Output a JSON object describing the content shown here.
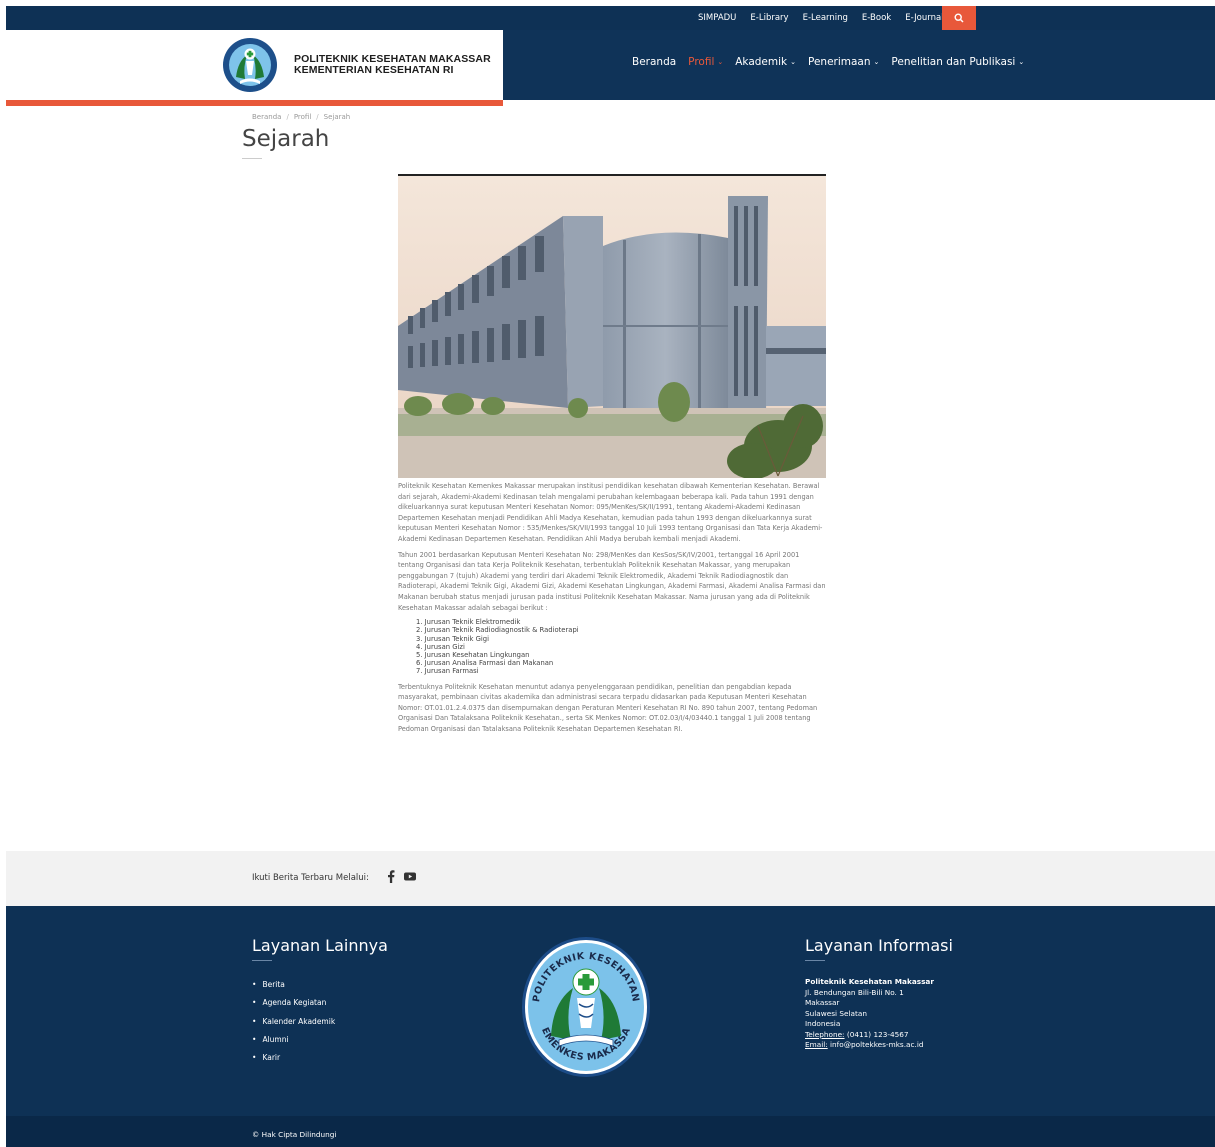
{
  "topbar": {
    "links": [
      "SIMPADU",
      "E-Library",
      "E-Learning",
      "E-Book",
      "E-Journal"
    ],
    "search_icon": "search-icon"
  },
  "header": {
    "logo_line1": "POLITEKNIK KESEHATAN MAKASSAR",
    "logo_line2": "KEMENTERIAN KESEHATAN RI",
    "nav": [
      {
        "label": "Beranda"
      },
      {
        "label": "Profil"
      },
      {
        "label": "Akademik"
      },
      {
        "label": "Penerimaan"
      },
      {
        "label": "Penelitian dan Publikasi"
      }
    ]
  },
  "breadcrumb": [
    "Beranda",
    "Profil",
    "Sejarah"
  ],
  "page_title": "Sejarah",
  "article": {
    "paragraph1": "Politeknik Kesehatan Kemenkes Makassar merupakan institusi pendidikan kesehatan dibawah Kementerian Kesehatan. Berawal dari sejarah, Akademi-Akademi Kedinasan telah mengalami perubahan kelembagaan beberapa kali. Pada tahun 1991 dengan dikeluarkannya surat keputusan Menteri Kesehatan Nomor: 095/MenKes/SK/II/1991, tentang Akademi-Akademi Kedinasan Departemen Kesehatan menjadi Pendidikan Ahli Madya Kesehatan, kemudian pada tahun 1993 dengan dikeluarkannya surat keputusan Menteri Kesehatan Nomor : 535/Menkes/SK/VII/1993 tanggal 10 Juli 1993 tentang Organisasi dan Tata Kerja Akademi-Akademi Kedinasan Departemen Kesehatan. Pendidikan Ahli Madya berubah kembali menjadi Akademi.",
    "paragraph2": "Tahun 2001 berdasarkan Keputusan Menteri Kesehatan No: 298/MenKes dan KesSos/SK/IV/2001, tertanggal 16 April 2001 tentang Organisasi dan tata Kerja Politeknik Kesehatan, terbentuklah Politeknik Kesehatan Makassar, yang merupakan penggabungan 7 (tujuh) Akademi yang terdiri dari Akademi Teknik Elektromedik, Akademi Teknik Radiodiagnostik dan Radioterapi, Akademi Teknik Gigi, Akademi Gizi, Akademi Kesehatan Lingkungan, Akademi Farmasi, Akademi Analisa Farmasi dan Makanan berubah status menjadi jurusan pada institusi Politeknik Kesehatan Makassar. Nama jurusan yang ada di Politeknik Kesehatan Makassar adalah sebagai berikut :",
    "list": [
      "1. Jurusan Teknik Elektromedik",
      "2. Jurusan Teknik Radiodiagnostik & Radioterapi",
      "3. Jurusan Teknik Gigi",
      "4. Jurusan Gizi",
      "5. Jurusan Kesehatan Lingkungan",
      "6. Jurusan Analisa Farmasi dan Makanan",
      "7. Jurusan Farmasi"
    ],
    "paragraph3": "Terbentuknya Politeknik Kesehatan menuntut adanya penyelenggaraan pendidikan, penelitian dan pengabdian kepada masyarakat, pembinaan civitas akademika dan administrasi secara terpadu didasarkan pada Keputusan Menteri Kesehatan Nomor: OT.01.01.2.4.0375 dan disempurnakan dengan Peraturan Menteri Kesehatan RI No. 890 tahun 2007, tentang Pedoman Organisasi Dan Tatalaksana Politeknik Kesehatan., serta SK Menkes Nomor: OT.02.03/I/4/03440.1 tanggal 1 Juli 2008 tentang Pedoman Organisasi dan Tatalaksana Politeknik Kesehatan Departemen Kesehatan RI."
  },
  "follow": {
    "label": "Ikuti Berita Terbaru Melalui:",
    "icons": [
      "facebook-icon",
      "youtube-icon"
    ]
  },
  "footer": {
    "services_title": "Layanan Lainnya",
    "services": [
      "Berita",
      "Agenda Kegiatan",
      "Kalender Akademik",
      "Alumni",
      "Karir"
    ],
    "emblem_text_top": "POLITEKNIK KESEHATAN",
    "emblem_text_bottom": "KEMENKES MAKASSAR",
    "info_title": "Layanan Informasi",
    "org": "Politeknik Kesehatan Makassar",
    "address1": "Jl. Bendungan Bili-Bili No. 1",
    "city": "Makassar",
    "province": "Sulawesi Selatan",
    "country": "Indonesia",
    "phone_label": "Telephone:",
    "phone": "(0411) 123-4567",
    "email_label": "Email:",
    "email": "info@poltekkes-mks.ac.id"
  },
  "copyright": "© Hak Cipta Dilindungi",
  "colors": {
    "navy": "#0e3155",
    "accent": "#e8583a"
  }
}
